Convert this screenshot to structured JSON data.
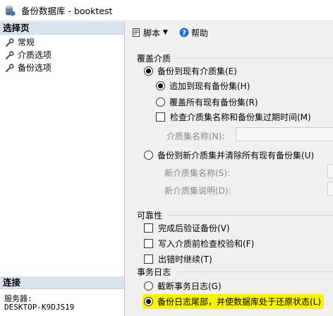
{
  "window": {
    "title": "备份数据库 - booktest"
  },
  "sidebar": {
    "header": "选择页",
    "items": [
      {
        "label": "常规",
        "icon": "wrench-icon"
      },
      {
        "label": "介质选项",
        "icon": "wrench-icon"
      },
      {
        "label": "备份选项",
        "icon": "wrench-icon"
      }
    ],
    "connection": {
      "header": "连接",
      "server_label": "服务器:",
      "server_value": "DESKTOP-K9DJS19"
    }
  },
  "toolbar": {
    "script_label": "脚本",
    "help_label": "帮助"
  },
  "media": {
    "section_label": "覆盖介质",
    "backup_existing": "备份到现有介质集(E)",
    "append": "追加到现有备份集(H)",
    "overwrite": "覆盖所有现有备份集(R)",
    "check_name": "检查介质集名称和备份集过期时间(M)",
    "media_set_name": "介质集名称(N):",
    "backup_new": "备份到新介质集并清除所有现有备份集(U)",
    "new_media_set_name": "新介质集名称(S):",
    "new_media_set_desc": "新介质集说明(D):"
  },
  "reliability": {
    "section_label": "可靠性",
    "verify": "完成后验证备份(V)",
    "checksum": "写入介质前检查校验和(F)",
    "continue_on_error": "出错时继续(T)"
  },
  "log": {
    "section_label": "事务日志",
    "truncate": "截断事务日志(G)",
    "tail": "备份日志尾部，并使数据库处于还原状态(L)"
  },
  "colors": {
    "highlight": "#f8f400",
    "section_header": "#d9e3f0"
  }
}
